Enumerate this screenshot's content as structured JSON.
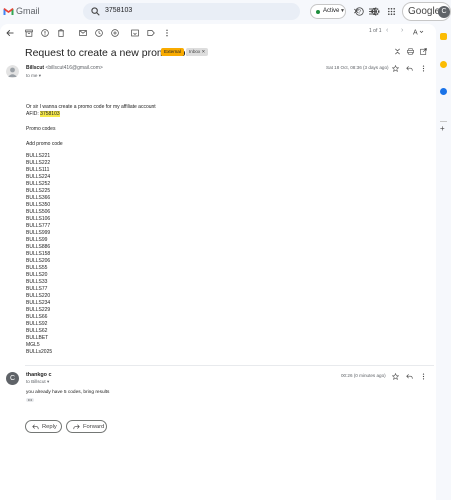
{
  "app": {
    "name": "Gmail"
  },
  "search": {
    "query": "3758103"
  },
  "status": {
    "label": "Active",
    "color": "#1e8e3e"
  },
  "account": {
    "brand": "Google",
    "initial": "C"
  },
  "pager": {
    "text": "1 of 1"
  },
  "email": {
    "subject": "Request to create a new promo code",
    "labels": {
      "external": "External",
      "inbox": "Inbox"
    },
    "message1": {
      "sender_name": "Billscut",
      "sender_email": "<billscut416@gmail.com>",
      "to": "to me",
      "date": "Sat 18 Oct, 08:36 (3 days ago)",
      "lines": [
        "Or sir I wanna create a promo code for my affiliate account",
        "Promo codes",
        "Add promo code"
      ],
      "afid_label": "AFID:",
      "afid_value": "3758103",
      "codes": [
        "BULLS221",
        "BULLS222",
        "BULLS111",
        "BULLS224",
        "BULLS252",
        "BULLS225",
        "BULLS366",
        "BULLS350",
        "BULLS506",
        "BULLS106",
        "BULLS777",
        "BULLS999",
        "BULLS99",
        "BULLS886",
        "BULLS158",
        "BULLS206",
        "BULLS55",
        "BULLS20",
        "BULLS33",
        "BULLS77",
        "BULLS220",
        "BULLS234",
        "BULLS229",
        "BULLS66",
        "BULLS92",
        "BULLS62",
        "BULLBET",
        "MGL5",
        "BULLs2025"
      ]
    },
    "message2": {
      "sender_name": "thankgo c",
      "to": "to Billscut",
      "date": "00:26 (0 minutes ago)",
      "text": "you already have 5 codes, bring results",
      "ellipsis": "•••"
    }
  },
  "actions": {
    "reply": "Reply",
    "forward": "Forward"
  }
}
